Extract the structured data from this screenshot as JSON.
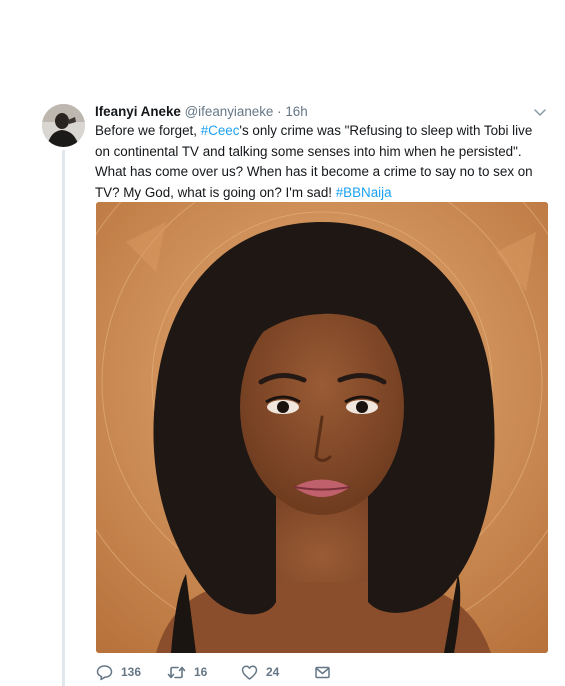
{
  "tweet": {
    "author_name": "Ifeanyi Aneke",
    "author_handle": "@ifeanyianeke",
    "separator": "·",
    "timestamp": "16h",
    "text_before": "Before we forget, ",
    "hashtag_1": "#Ceec",
    "text_middle": "'s only crime was \"Refusing to sleep with Tobi live on continental TV and talking some senses into him when he persisted\". What has come over us? When has it become a crime to say no to sex on TV? My God, what is going on? I'm sad! ",
    "hashtag_2": "#BBNaija"
  },
  "actions": {
    "reply_count": "136",
    "retweet_count": "16",
    "like_count": "24"
  },
  "icons": {
    "more": "chevron-down-icon",
    "reply": "reply-icon",
    "retweet": "retweet-icon",
    "like": "heart-icon",
    "message": "envelope-icon"
  },
  "colors": {
    "link": "#1da1f2",
    "secondary_text": "#657786",
    "primary_text": "#14171a",
    "thread_line": "#e1e8ed",
    "photo_background": "#c98c53"
  }
}
